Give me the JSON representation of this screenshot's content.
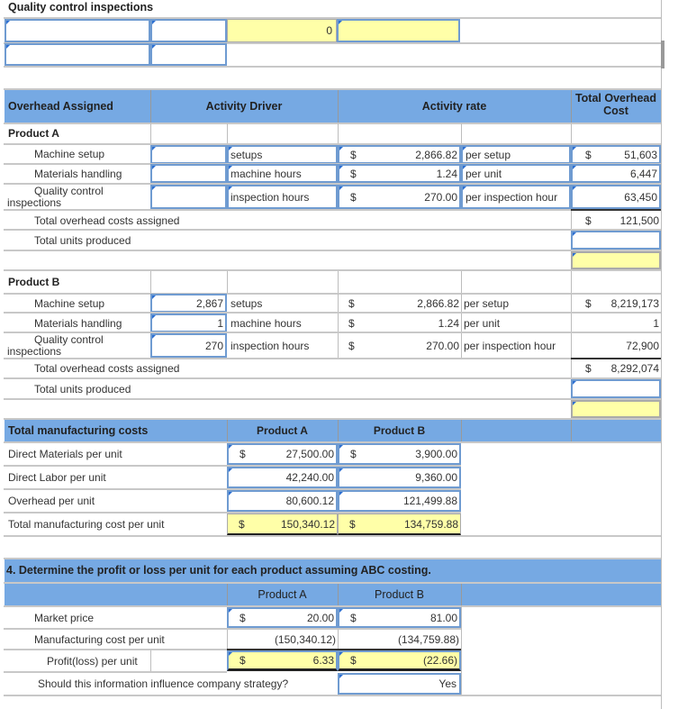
{
  "top": {
    "section_label": "Quality control inspections",
    "row1_value": "0"
  },
  "overhead_table": {
    "headers": {
      "overhead_assigned": "Overhead Assigned",
      "activity_driver": "Activity Driver",
      "activity_rate": "Activity rate",
      "total_overhead_cost": "Total Overhead Cost"
    },
    "product_a": {
      "title": "Product A",
      "rows": [
        {
          "label": "Machine setup",
          "driver_qty": "",
          "driver_unit": "setups",
          "currency": "$",
          "rate": "2,866.82",
          "rate_unit": "per setup",
          "cost_currency": "$",
          "cost": "51,603"
        },
        {
          "label": "Materials handling",
          "driver_qty": "",
          "driver_unit": "machine hours",
          "currency": "$",
          "rate": "1.24",
          "rate_unit": "per unit",
          "cost_currency": "",
          "cost": "6,447"
        },
        {
          "label_line1": "Quality control",
          "label_line2": "inspections",
          "driver_qty": "",
          "driver_unit": "inspection hours",
          "currency": "$",
          "rate": "270.00",
          "rate_unit": "per inspection hour",
          "cost_currency": "",
          "cost": "63,450"
        }
      ],
      "total_label": "Total overhead costs assigned",
      "total_currency": "$",
      "total_value": "121,500",
      "units_label": "Total units produced",
      "units_value": "",
      "per_unit_value": ""
    },
    "product_b": {
      "title": "Product B",
      "rows": [
        {
          "label": "Machine setup",
          "driver_qty": "2,867",
          "driver_unit": "setups",
          "currency": "$",
          "rate": "2,866.82",
          "rate_unit": "per setup",
          "cost_currency": "$",
          "cost": "8,219,173"
        },
        {
          "label": "Materials handling",
          "driver_qty": "1",
          "driver_unit": "machine hours",
          "currency": "$",
          "rate": "1.24",
          "rate_unit": "per unit",
          "cost_currency": "",
          "cost": "1"
        },
        {
          "label_line1": "Quality control",
          "label_line2": "inspections",
          "driver_qty": "270",
          "driver_unit": "inspection hours",
          "currency": "$",
          "rate": "270.00",
          "rate_unit": "per inspection hour",
          "cost_currency": "",
          "cost": "72,900"
        }
      ],
      "total_label": "Total overhead costs assigned",
      "total_currency": "$",
      "total_value": "8,292,074",
      "units_label": "Total units produced",
      "units_value": "",
      "per_unit_value": ""
    }
  },
  "manufacturing": {
    "header": "Total manufacturing costs",
    "col_a": "Product A",
    "col_b": "Product B",
    "rows": [
      {
        "label": "Direct Materials per unit",
        "a_currency": "$",
        "a": "27,500.00",
        "b_currency": "$",
        "b": "3,900.00"
      },
      {
        "label": "Direct Labor per unit",
        "a_currency": "",
        "a": "42,240.00",
        "b_currency": "",
        "b": "9,360.00"
      },
      {
        "label": "Overhead per unit",
        "a_currency": "",
        "a": "80,600.12",
        "b_currency": "",
        "b": "121,499.88"
      },
      {
        "label": "Total manufacturing cost per unit",
        "a_currency": "$",
        "a": "150,340.12",
        "b_currency": "$",
        "b": "134,759.88"
      }
    ]
  },
  "profit": {
    "question": "4. Determine the profit or loss per unit for each product assuming ABC costing.",
    "col_a": "Product A",
    "col_b": "Product B",
    "market_price_label": "Market price",
    "market_a_currency": "$",
    "market_a": "20.00",
    "market_b_currency": "$",
    "market_b": "81.00",
    "mfg_cost_label": "Manufacturing cost per unit",
    "mfg_a": "(150,340.12)",
    "mfg_b": "(134,759.88)",
    "profit_label": "Profit(loss) per unit",
    "profit_a_currency": "$",
    "profit_a": "6.33",
    "profit_b_currency": "$",
    "profit_b": "(22.66)",
    "strategy_label": "Should this information influence company strategy?",
    "strategy_answer": "Yes"
  }
}
